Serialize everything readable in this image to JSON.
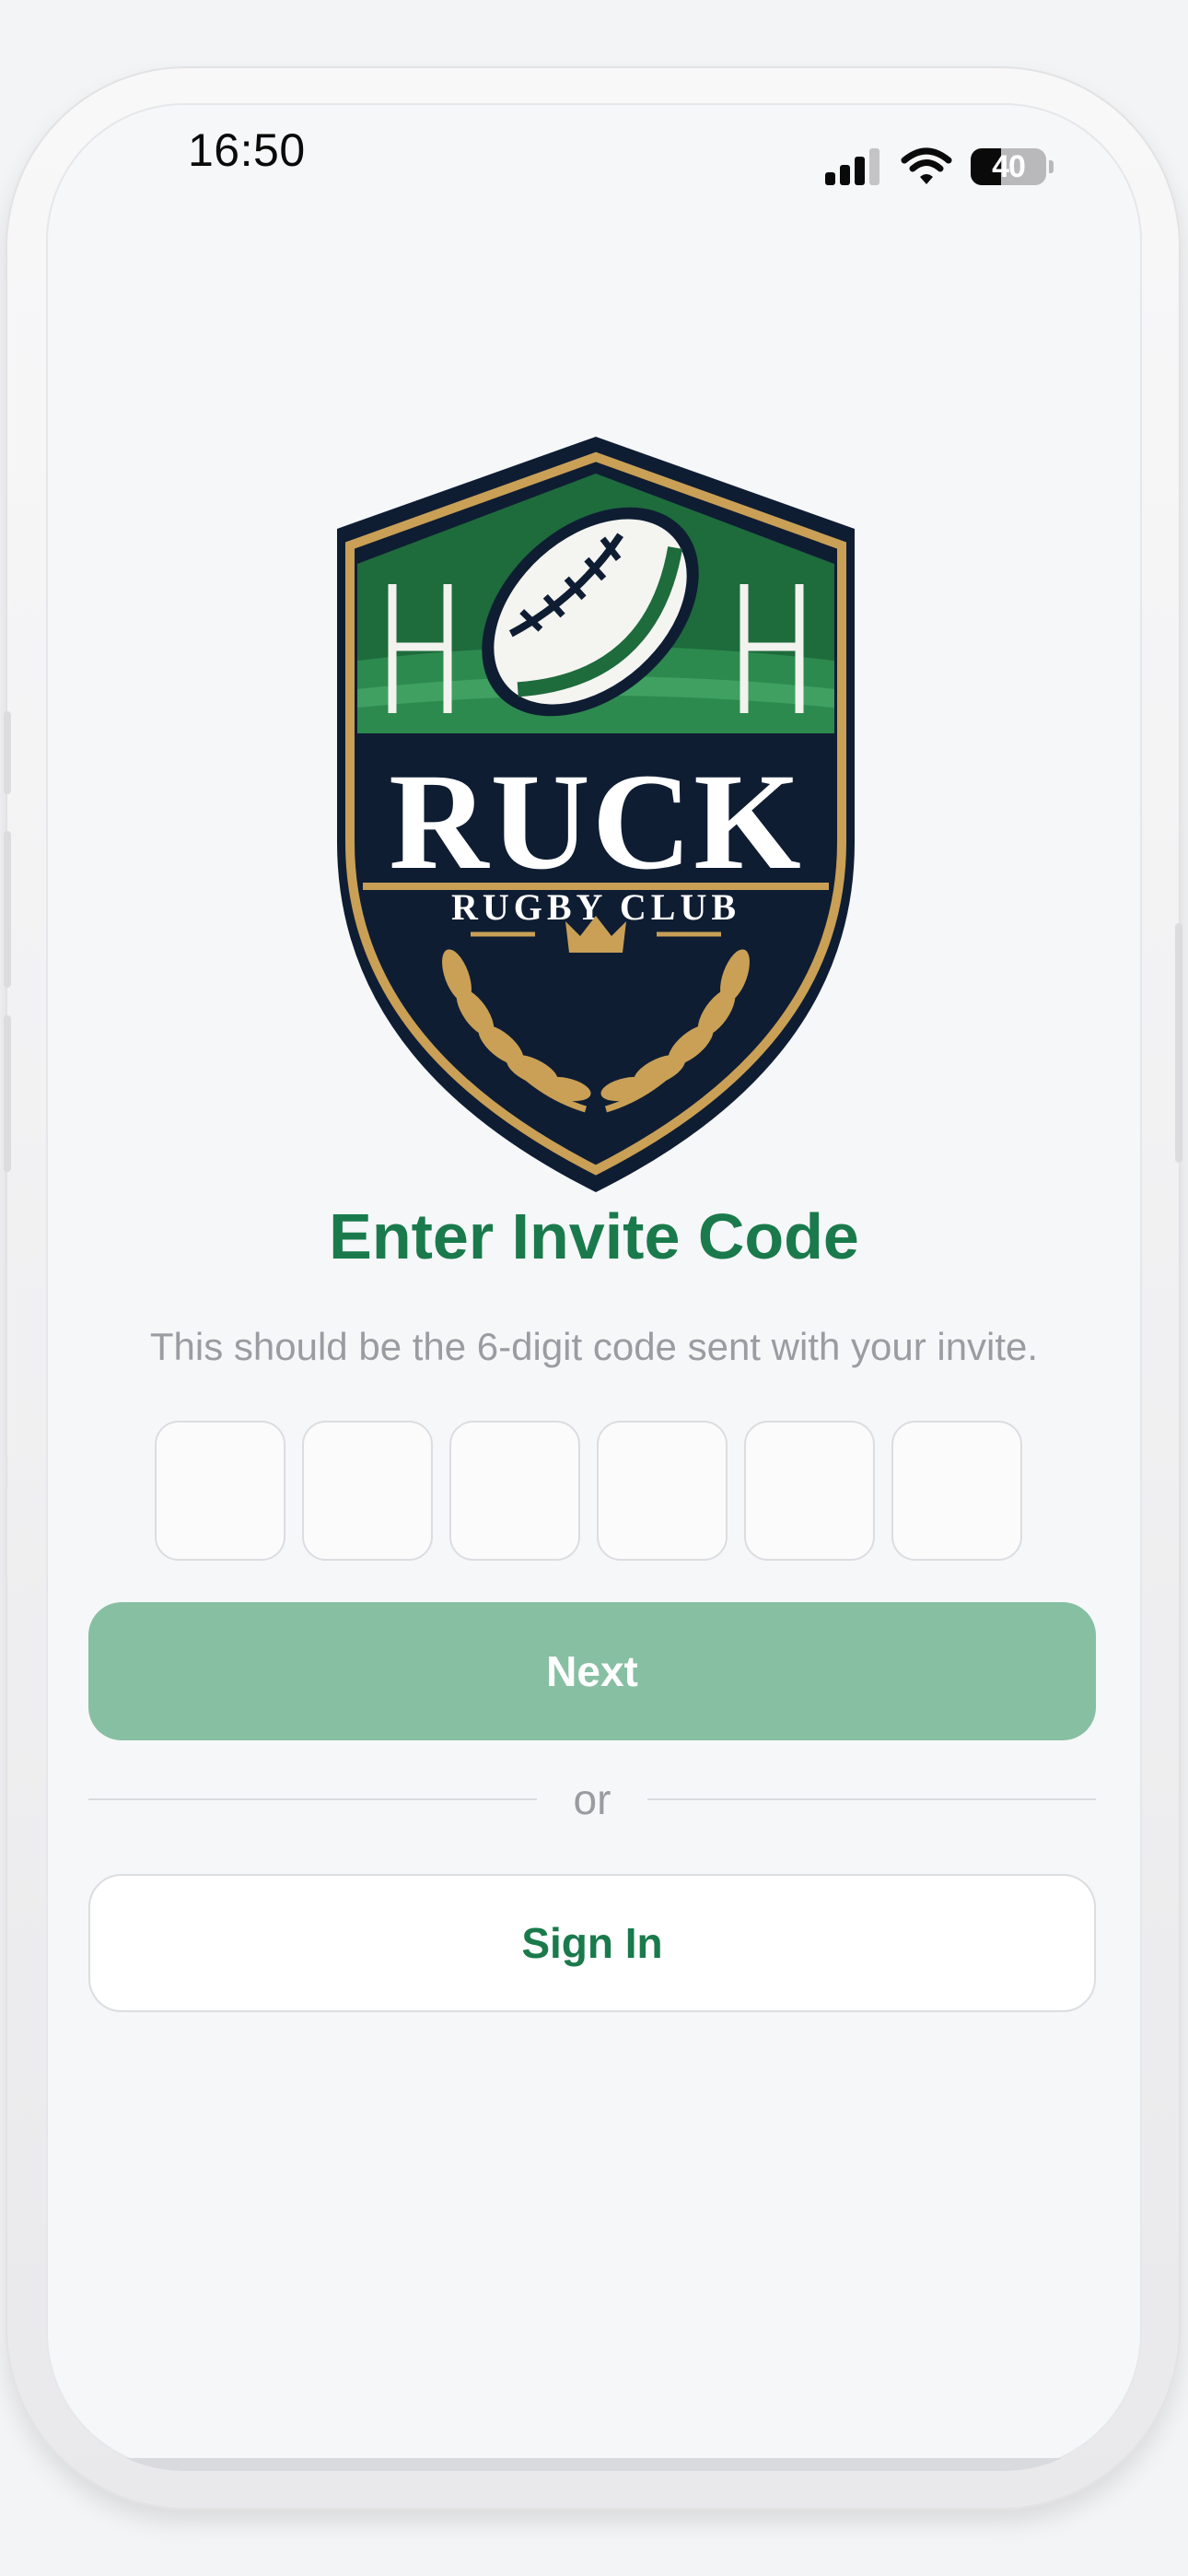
{
  "status_bar": {
    "time": "16:50",
    "battery_level": "40",
    "battery_fraction": 0.4
  },
  "logo": {
    "wordmark": "RUCK",
    "tagline": "RUGBY CLUB"
  },
  "invite": {
    "title": "Enter Invite Code",
    "subtitle": "This should be the 6-digit code sent with your invite.",
    "code_digits": [
      "",
      "",
      "",
      "",
      "",
      ""
    ]
  },
  "actions": {
    "next_label": "Next",
    "divider_label": "or",
    "signin_label": "Sign In"
  },
  "colors": {
    "brand_green": "#1a7a4c",
    "next_disabled": "#87bfa2",
    "crest_navy": "#0f1d33",
    "crest_gold": "#c9a056"
  },
  "icons": [
    "signal-icon",
    "wifi-icon",
    "battery-icon",
    "ruck-rugby-club-crest"
  ]
}
